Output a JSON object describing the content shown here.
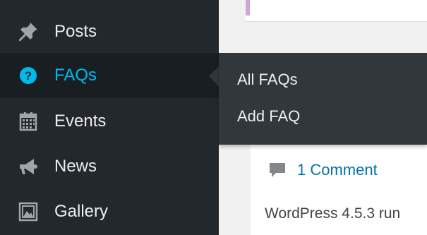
{
  "sidebar": {
    "items": [
      {
        "label": "Posts",
        "icon": "pushpin-icon"
      },
      {
        "label": "FAQs",
        "icon": "question-circle-icon"
      },
      {
        "label": "Events",
        "icon": "calendar-icon"
      },
      {
        "label": "News",
        "icon": "megaphone-icon"
      },
      {
        "label": "Gallery",
        "icon": "gallery-icon"
      }
    ],
    "active_index": 1
  },
  "flyout": {
    "items": [
      {
        "label": "All FAQs"
      },
      {
        "label": "Add FAQ"
      }
    ]
  },
  "content": {
    "comment_link": "1 Comment",
    "body_text": "WordPress 4.5.3 run"
  },
  "colors": {
    "sidebar_bg": "#23282d",
    "active_bg": "#191e23",
    "accent": "#00b9eb",
    "flyout_bg": "#32373c",
    "link": "#0073aa"
  }
}
